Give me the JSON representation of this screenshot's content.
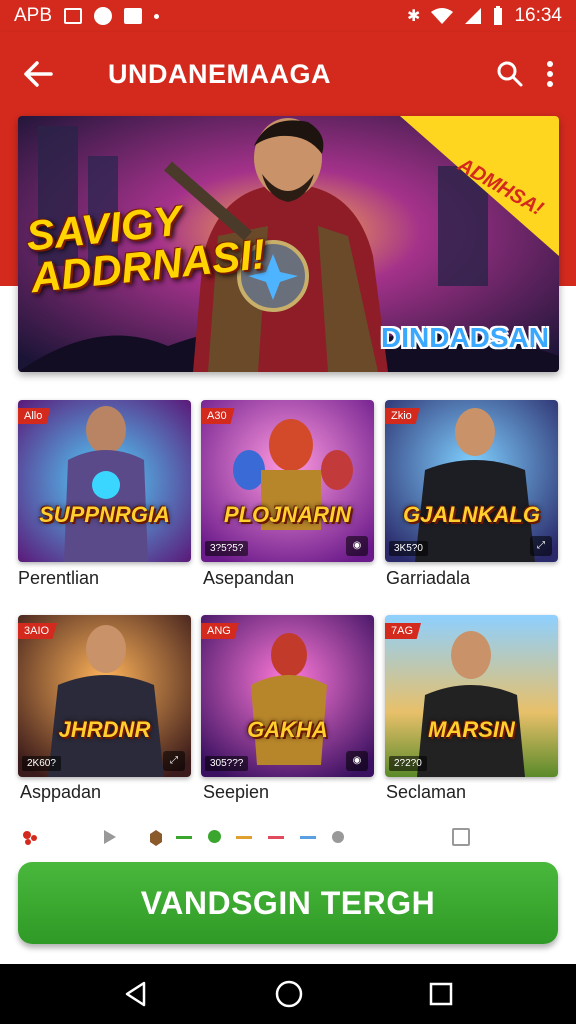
{
  "status_bar": {
    "carrier": "APB",
    "time": "16:34"
  },
  "app_bar": {
    "title": "UNDANEMAAGA"
  },
  "hero": {
    "title": "SAVIGY ADDRNASI!",
    "ribbon": "ADMHSA!",
    "subtitle": "DINDADSAN"
  },
  "tiles": [
    {
      "tag": "Allo",
      "logo": "SUPPNRGIA",
      "count": "",
      "caption": "Perentlian"
    },
    {
      "tag": "A30",
      "logo": "PLOJNARIN",
      "count": "3?5?5?",
      "caption": "Asepandan"
    },
    {
      "tag": "Zkio",
      "logo": "GJALNKALG",
      "count": "3K5?0",
      "caption": "Garriadala"
    },
    {
      "tag": "3AIO",
      "logo": "JHRDNR",
      "count": "2K60?",
      "caption": "Asppadan"
    },
    {
      "tag": "ANG",
      "logo": "GAKHA",
      "count": "305???",
      "caption": "Seepien"
    },
    {
      "tag": "7AG",
      "logo": "MARSIN",
      "count": "2?2?0",
      "caption": "Seclaman"
    }
  ],
  "cta": {
    "label": "VANDSGIN TERGH"
  },
  "colors": {
    "primary": "#d42a1e",
    "cta": "#3aa62e"
  }
}
